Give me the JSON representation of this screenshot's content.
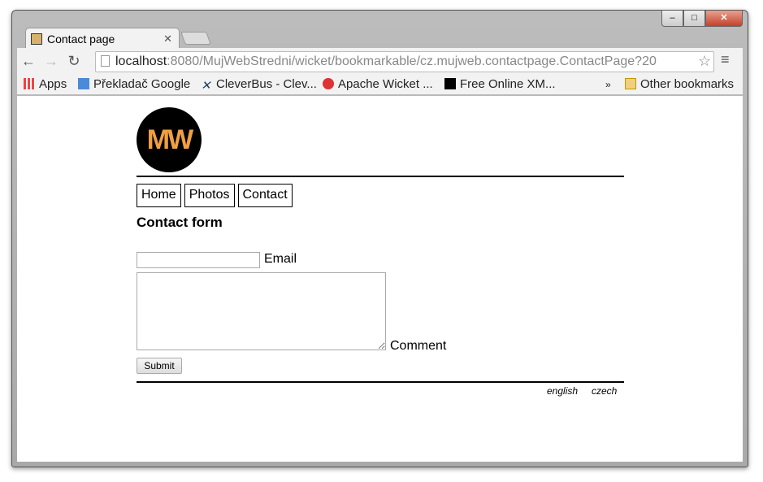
{
  "browser": {
    "tab_title": "Contact page",
    "url_host": "localhost",
    "url_rest": ":8080/MujWebStredni/wicket/bookmarkable/cz.mujweb.contactpage.ContactPage?20",
    "bookmarks": [
      "Apps",
      "Překladač Google",
      "CleverBus - Clev...",
      "Apache Wicket ...",
      "Free Online XM..."
    ],
    "overflow": "»",
    "other_bookmarks": "Other bookmarks"
  },
  "page": {
    "logo": "MW",
    "nav": [
      "Home",
      "Photos",
      "Contact"
    ],
    "heading": "Contact form",
    "email_label": "Email",
    "comment_label": "Comment",
    "submit": "Submit",
    "languages": [
      "english",
      "czech"
    ]
  }
}
